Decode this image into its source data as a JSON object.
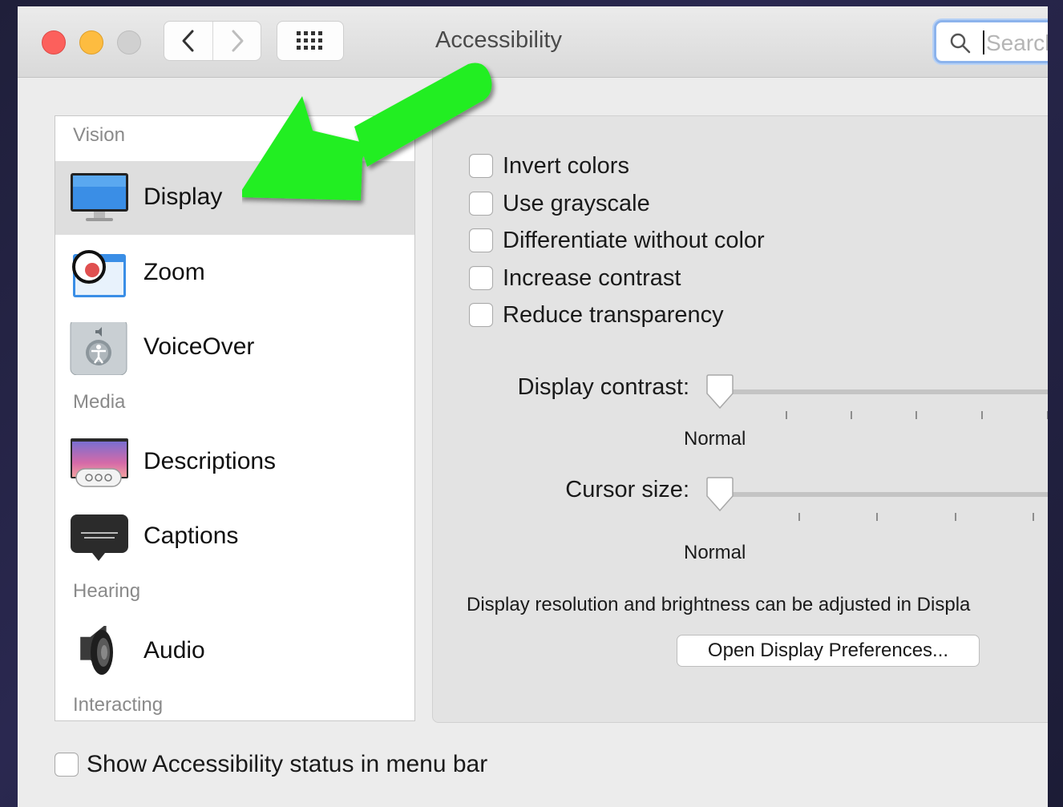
{
  "window": {
    "title": "Accessibility",
    "search": {
      "placeholder": "Search"
    }
  },
  "sidebar": {
    "sections": [
      {
        "label": "Vision"
      },
      {
        "label": "Media"
      },
      {
        "label": "Hearing"
      },
      {
        "label": "Interacting"
      }
    ],
    "items": [
      {
        "label": "Display",
        "icon": "display-icon",
        "selected": true
      },
      {
        "label": "Zoom",
        "icon": "zoom-icon"
      },
      {
        "label": "VoiceOver",
        "icon": "voiceover-icon"
      },
      {
        "label": "Descriptions",
        "icon": "descriptions-icon"
      },
      {
        "label": "Captions",
        "icon": "captions-icon"
      },
      {
        "label": "Audio",
        "icon": "audio-icon"
      }
    ]
  },
  "display_panel": {
    "checkboxes": [
      {
        "label": "Invert colors",
        "checked": false
      },
      {
        "label": "Use grayscale",
        "checked": false
      },
      {
        "label": "Differentiate without color",
        "checked": false
      },
      {
        "label": "Increase contrast",
        "checked": false
      },
      {
        "label": "Reduce transparency",
        "checked": false
      }
    ],
    "display_contrast": {
      "label": "Display contrast:",
      "value_label": "Normal"
    },
    "cursor_size": {
      "label": "Cursor size:",
      "value_label": "Normal"
    },
    "note": "Display resolution and brightness can be adjusted in Displa",
    "open_button": "Open Display Preferences..."
  },
  "footer": {
    "status_checkbox": {
      "label": "Show Accessibility status in menu bar",
      "checked": false
    }
  },
  "colors": {
    "annotation_arrow": "#22ee22",
    "search_focus": "#8cb3ec",
    "close": "#fc605c",
    "minimize": "#fdbc40"
  }
}
